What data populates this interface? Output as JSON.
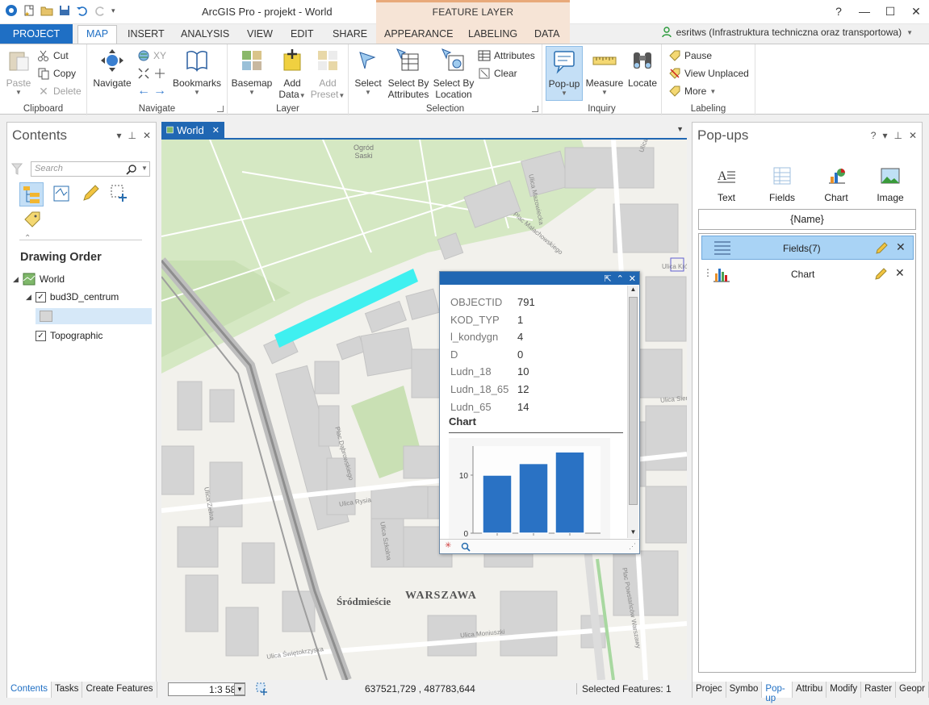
{
  "titlebar": {
    "title": "ArcGIS Pro - projekt - World",
    "context_label": "FEATURE LAYER",
    "help": "?",
    "minimize": "—",
    "maximize": "☐",
    "close": "✕"
  },
  "tabs": {
    "project": "PROJECT",
    "map": "MAP",
    "insert": "INSERT",
    "analysis": "ANALYSIS",
    "view": "VIEW",
    "edit": "EDIT",
    "share": "SHARE",
    "appearance": "APPEARANCE",
    "labeling": "LABELING",
    "data": "DATA"
  },
  "user": {
    "name": "esritws (Infrastruktura techniczna oraz transportowa)"
  },
  "ribbon": {
    "clipboard": {
      "label": "Clipboard",
      "paste": "Paste",
      "cut": "Cut",
      "copy": "Copy",
      "delete": "Delete"
    },
    "navigate": {
      "label": "Navigate",
      "navigate": "Navigate",
      "xy": "XY",
      "bookmarks": "Bookmarks"
    },
    "layer": {
      "label": "Layer",
      "basemap": "Basemap",
      "add_data": "Add",
      "add_data2": "Data",
      "add_preset": "Add",
      "add_preset2": "Preset"
    },
    "selection": {
      "label": "Selection",
      "select": "Select",
      "by_attr": "Select By",
      "by_attr2": "Attributes",
      "by_loc": "Select By",
      "by_loc2": "Location",
      "attributes": "Attributes",
      "clear": "Clear"
    },
    "inquiry": {
      "label": "Inquiry",
      "popup": "Pop-up",
      "measure": "Measure",
      "locate": "Locate"
    },
    "labeling": {
      "label": "Labeling",
      "pause": "Pause",
      "view_unplaced": "View Unplaced",
      "more": "More"
    }
  },
  "contents": {
    "title": "Contents",
    "search_placeholder": "Search",
    "drawing_order": "Drawing Order",
    "items": [
      "World",
      "bud3D_centrum",
      "Topographic"
    ],
    "bottom_tabs": [
      "Contents",
      "Tasks",
      "Create Features"
    ]
  },
  "map": {
    "tab": "World",
    "scale": "1:3 585",
    "coords": "637521,729 , 487783,644",
    "selected": "Selected Features: 1",
    "labels": {
      "ogrod": "Ogród",
      "saski": "Saski",
      "srodmiescie": "Śródmieście",
      "warszawa": "WARSZAWA",
      "mazowiecka": "Ulica Mazowiecka",
      "marszalkowska": "Ulica Marszałkowska",
      "krolewska": "Ulica Królewska",
      "malachowskiego": "Plac Małachowskiego",
      "rysia": "Ulica Rysia",
      "zielna": "Ulica Zielna",
      "dabrowskiego": "Plac Dąbrowskiego",
      "szkolna": "Ulica Szkolna",
      "swietokrzyska": "Ulica Świętokrzyska",
      "moniuszki": "Ulica Moniuszki",
      "powstancow": "Plac Powstańców Warszawy",
      "sienkiewicza": "Ulica Sienkiewicza"
    }
  },
  "popup": {
    "fields": [
      {
        "name": "OBJECTID",
        "value": "791"
      },
      {
        "name": "KOD_TYP",
        "value": "1"
      },
      {
        "name": "l_kondygn",
        "value": "4"
      },
      {
        "name": "D",
        "value": "0"
      },
      {
        "name": "Ludn_18",
        "value": "10"
      },
      {
        "name": "Ludn_18_65",
        "value": "12"
      },
      {
        "name": "Ludn_65",
        "value": "14"
      }
    ],
    "chart_title": "Chart",
    "chart_values": [
      10,
      12,
      14
    ],
    "chart_ticks": [
      "10",
      "0"
    ]
  },
  "popups_pane": {
    "title": "Pop-ups",
    "tools": [
      "Text",
      "Fields",
      "Chart",
      "Image"
    ],
    "title_expr": "{Name}",
    "elements": [
      "Fields(7)",
      "Chart"
    ],
    "bottom_tabs": [
      "Projec",
      "Symbo",
      "Pop-up",
      "Attribu",
      "Modify",
      "Raster",
      "Geopr"
    ]
  },
  "colors": {
    "accent": "#1f6fc4",
    "selection": "#3ff0f0",
    "bar": "#2a72c4"
  }
}
